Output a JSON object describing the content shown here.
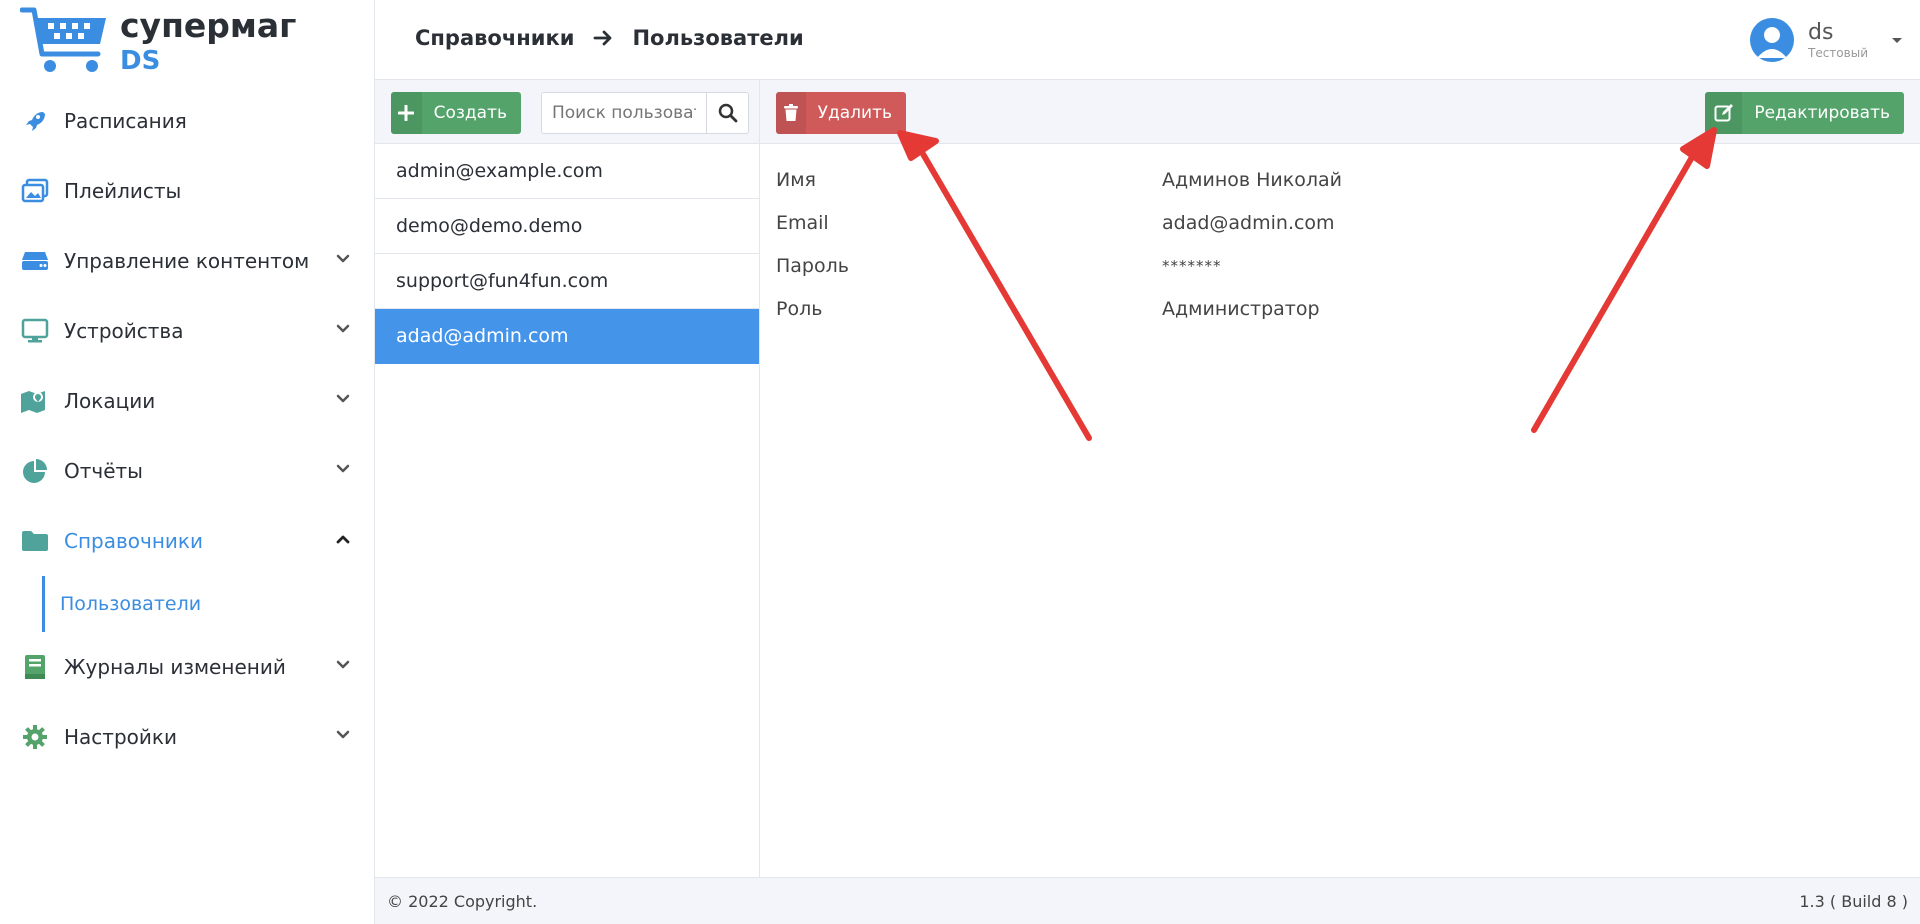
{
  "app": {
    "logo_word": "супермаг",
    "logo_sub": "DS"
  },
  "sidebar": {
    "items": [
      {
        "label": "Расписания",
        "icon": "rocket-icon",
        "expandable": false
      },
      {
        "label": "Плейлисты",
        "icon": "images-icon",
        "expandable": false
      },
      {
        "label": "Управление контентом",
        "icon": "server-icon",
        "expandable": true
      },
      {
        "label": "Устройства",
        "icon": "monitor-icon",
        "expandable": true
      },
      {
        "label": "Локации",
        "icon": "map-icon",
        "expandable": true
      },
      {
        "label": "Отчёты",
        "icon": "pie-chart-icon",
        "expandable": true
      },
      {
        "label": "Справочники",
        "icon": "folder-icon",
        "expandable": true,
        "active": true
      },
      {
        "label": "Журналы изменений",
        "icon": "book-icon",
        "expandable": true
      },
      {
        "label": "Настройки",
        "icon": "gear-icon",
        "expandable": true
      }
    ],
    "subitem": "Пользователи"
  },
  "header": {
    "breadcrumb": [
      "Справочники",
      "Пользователи"
    ],
    "user_name": "ds",
    "user_role": "Тестовый"
  },
  "list": {
    "create_label": "Создать",
    "search_placeholder": "Поиск пользователя",
    "users": [
      "admin@example.com",
      "demo@demo.demo",
      "support@fun4fun.com",
      "adad@admin.com"
    ],
    "selected_index": 3
  },
  "detail": {
    "delete_label": "Удалить",
    "edit_label": "Редактировать",
    "fields": [
      {
        "key": "Имя",
        "value": "Админов Николай"
      },
      {
        "key": "Email",
        "value": "adad@admin.com"
      },
      {
        "key": "Пароль",
        "value": "*******"
      },
      {
        "key": "Роль",
        "value": "Администратор"
      }
    ]
  },
  "footer": {
    "copyright": "© 2022 Copyright.",
    "version": "1.3 ( Build 8 )"
  },
  "colors": {
    "accent": "#3a8de0",
    "sidebar_icon": "#4fa39a",
    "green": "#53a36a",
    "red": "#d05a5a",
    "selected_row": "#4494ea",
    "annotation_arrow": "#e53935"
  }
}
